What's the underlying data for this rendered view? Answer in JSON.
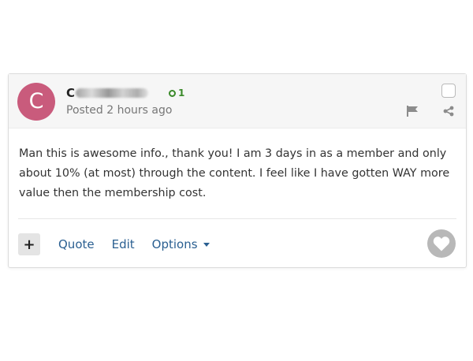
{
  "post": {
    "avatar_letter": "C",
    "author_visible": "C",
    "reputation": "1",
    "posted_time": "Posted 2 hours ago",
    "body": "Man this is awesome info., thank you! I am 3 days in as a member and only about 10% (at most) through the content. I feel like I have gotten WAY more value then the membership cost.",
    "icons": {
      "reputation": "reputation-circle-icon",
      "flag": "flag-icon",
      "share": "share-icon",
      "options_caret": "caret-down-icon",
      "like": "heart-icon"
    },
    "colors": {
      "avatar": "#c95b7c",
      "reputation": "#3b8a2a",
      "link": "#2a5f91",
      "like_button": "#b8b8b8"
    }
  },
  "actions": {
    "plus_label": "+",
    "quote_label": "Quote",
    "edit_label": "Edit",
    "options_label": "Options"
  }
}
